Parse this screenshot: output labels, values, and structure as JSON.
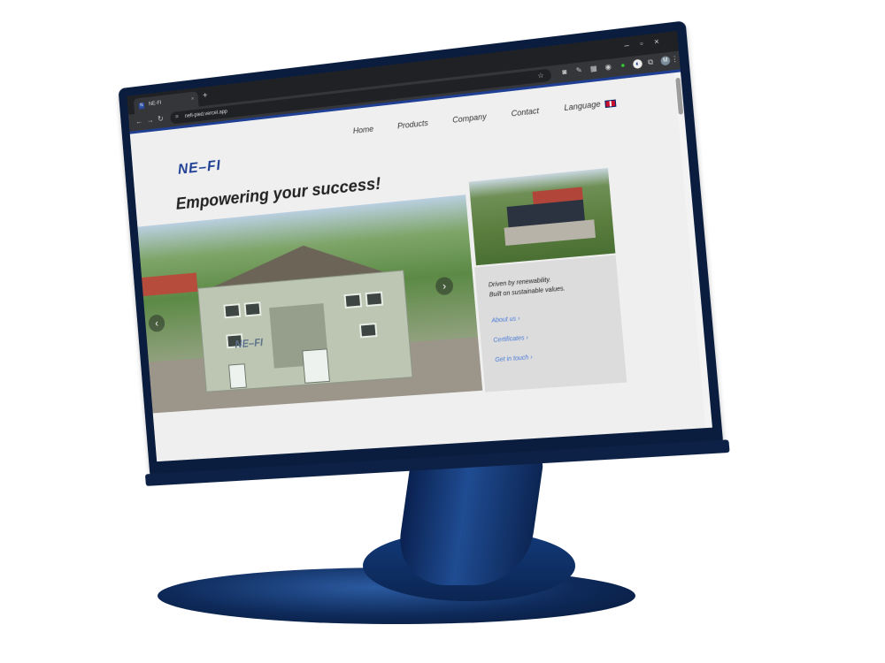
{
  "browser": {
    "tab_title": "NE-FI",
    "tab_favicon": "N",
    "url": "nefi-pied.vercel.app",
    "profile_initial": "M"
  },
  "site": {
    "logo": "NE–FI",
    "nav": [
      "Home",
      "Products",
      "Company",
      "Contact",
      "Language"
    ],
    "headline": "Empowering your success!",
    "building_sign": "NE–FI",
    "tagline_line1": "Driven by renewability.",
    "tagline_line2": "Built on sustainable values.",
    "links": [
      "About us ›",
      "Certificates ›",
      "Get in touch ›"
    ]
  },
  "icons": {
    "prev": "‹",
    "next": "›"
  },
  "colors": {
    "brand": "#1f3f94",
    "link": "#4a7bd8",
    "monitor": "#0b1d3f"
  }
}
